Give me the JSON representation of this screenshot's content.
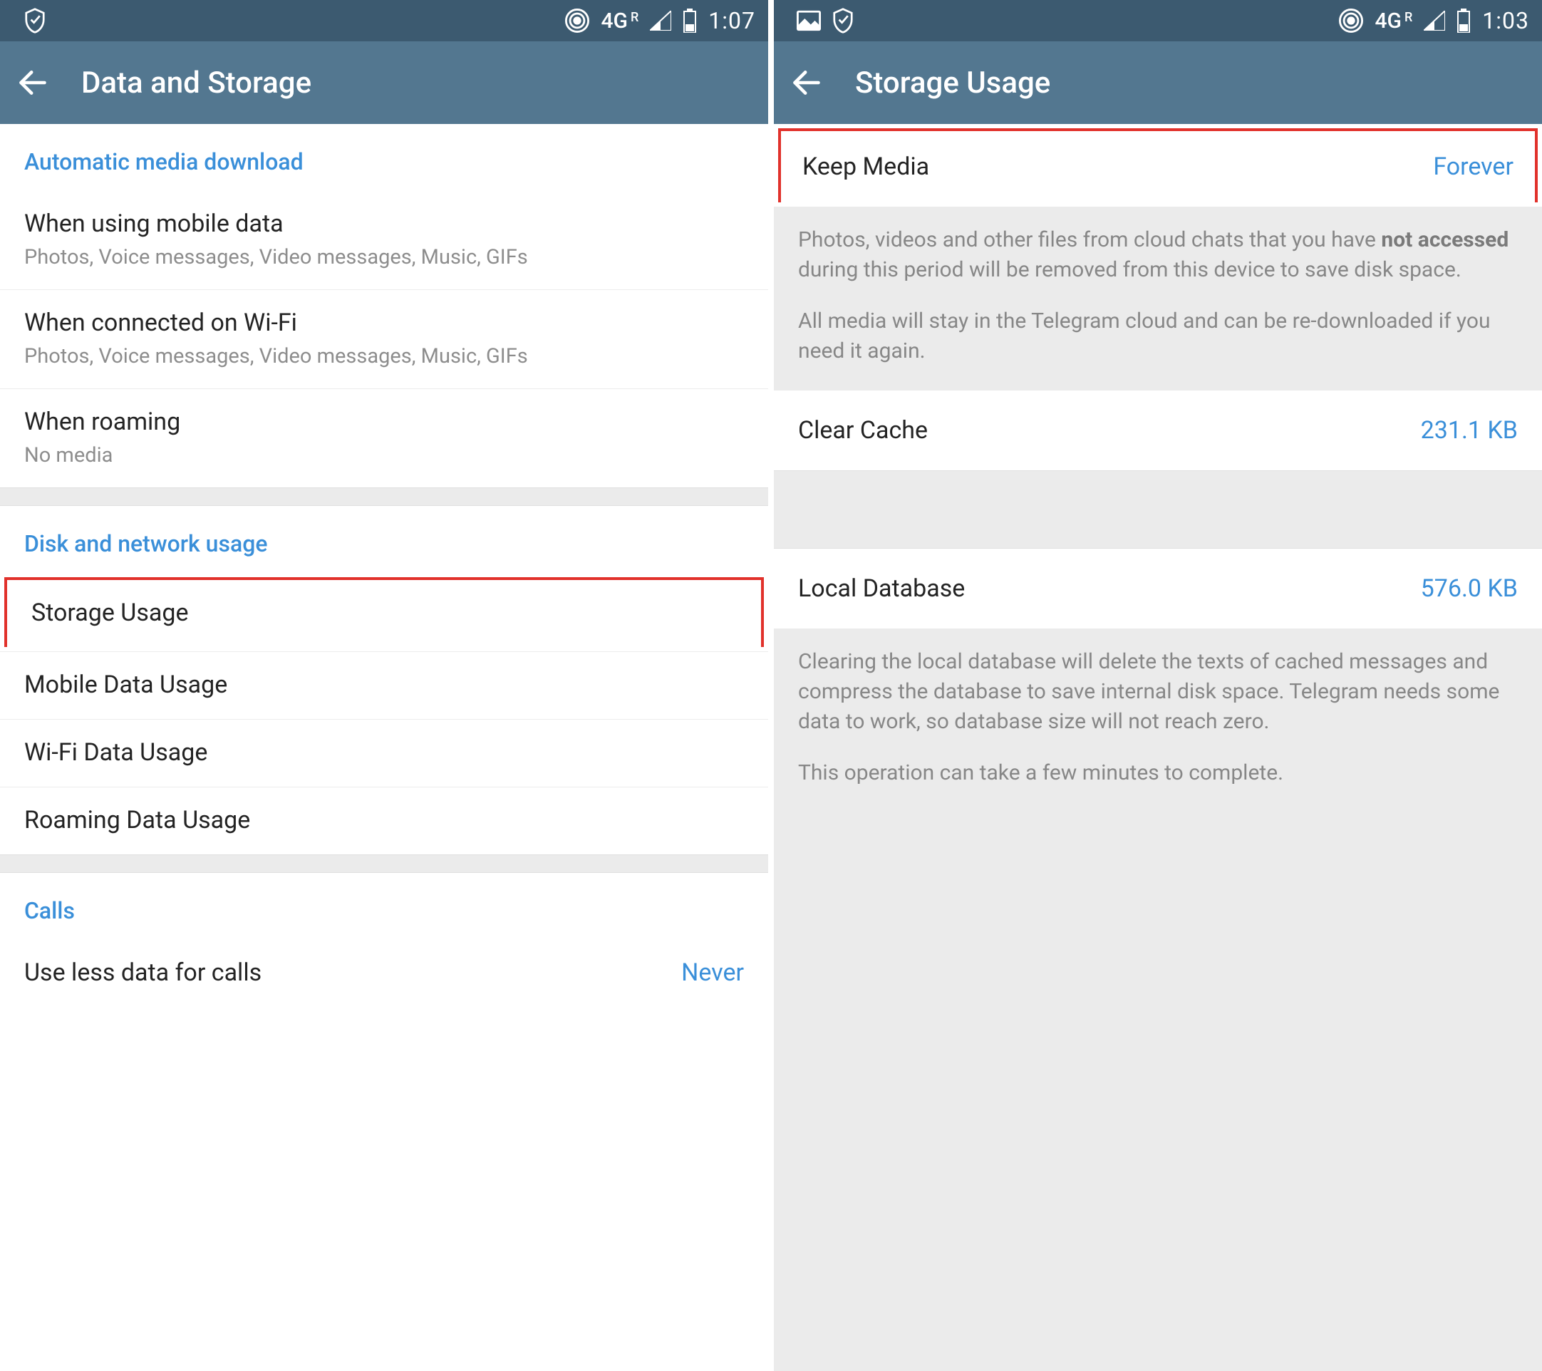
{
  "left": {
    "status": {
      "net": "4G",
      "roam": "R",
      "time": "1:07"
    },
    "title": "Data and Storage",
    "sections": {
      "media": {
        "header": "Automatic media download",
        "mobile": {
          "title": "When using mobile data",
          "sub": "Photos, Voice messages, Video messages, Music, GIFs"
        },
        "wifi": {
          "title": "When connected on Wi-Fi",
          "sub": "Photos, Voice messages, Video messages, Music, GIFs"
        },
        "roaming": {
          "title": "When roaming",
          "sub": "No media"
        }
      },
      "usage": {
        "header": "Disk and network usage",
        "storage": "Storage Usage",
        "mobile": "Mobile Data Usage",
        "wifi": "Wi-Fi Data Usage",
        "roaming": "Roaming Data Usage"
      },
      "calls": {
        "header": "Calls",
        "lessdata": {
          "title": "Use less data for calls",
          "value": "Never"
        }
      }
    }
  },
  "right": {
    "status": {
      "net": "4G",
      "roam": "R",
      "time": "1:03"
    },
    "title": "Storage Usage",
    "keepmedia": {
      "title": "Keep Media",
      "value": "Forever"
    },
    "info1_a": "Photos, videos and other files from cloud chats that you have ",
    "info1_bold": "not accessed",
    "info1_b": " during this period will be removed from this device to save disk space.",
    "info1_c": "All media will stay in the Telegram cloud and can be re-downloaded if you need it again.",
    "clearcache": {
      "title": "Clear Cache",
      "value": "231.1 KB"
    },
    "localdb": {
      "title": "Local Database",
      "value": "576.0 KB"
    },
    "info2_a": "Clearing the local database will delete the texts of cached messages and compress the database to save internal disk space. Telegram needs some data to work, so database size will not reach zero.",
    "info2_b": "This operation can take a few minutes to complete."
  }
}
